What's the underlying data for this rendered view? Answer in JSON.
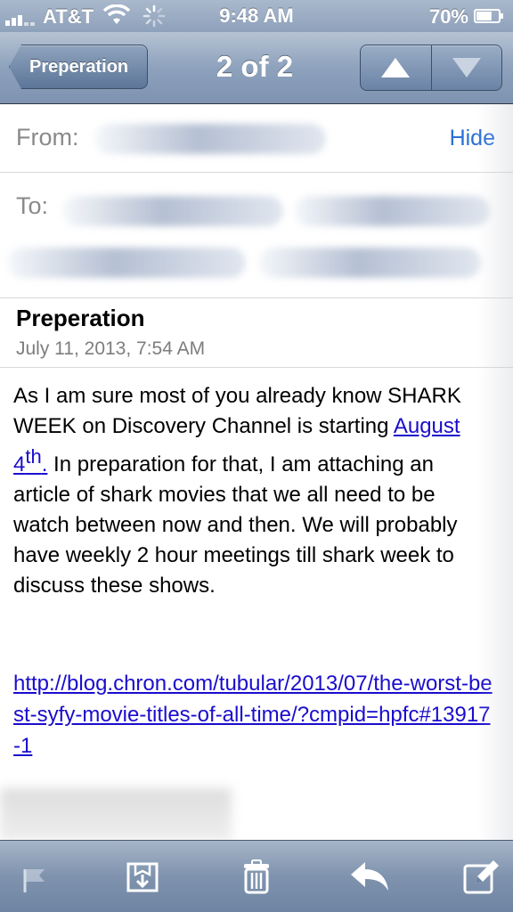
{
  "status_bar": {
    "carrier": "AT&T",
    "time": "9:48 AM",
    "battery_percent": "70%",
    "battery_level": 0.7,
    "icons": [
      "signal-icon",
      "wifi-icon",
      "activity-spinner-icon",
      "battery-icon"
    ]
  },
  "nav": {
    "back_label": "Preperation",
    "title": "2 of 2",
    "prev_icon": "arrow-up-icon",
    "next_icon": "arrow-down-icon"
  },
  "header": {
    "from_label": "From:",
    "to_label": "To:",
    "hide_label": "Hide"
  },
  "message": {
    "subject": "Preperation",
    "date": "July 11, 2013, 7:54 AM",
    "body_part1": "As I am sure most of you already know SHARK WEEK on Discovery Channel is starting ",
    "date_link": "August 4",
    "date_link_sup": "th",
    "date_link_end": ".",
    "body_part2": " In preparation for that, I am attaching an article of shark movies that we all need to be watch between now and then. We will probably have weekly 2 hour meetings till shark week to discuss these shows.",
    "url": "http://blog.chron.com/tubular/2013/07/the-worst-best-syfy-movie-titles-of-all-time/?cmpid=hpfc#13917-1"
  },
  "toolbar": {
    "icons": [
      "flag-icon",
      "move-to-folder-icon",
      "trash-icon",
      "reply-icon",
      "compose-icon"
    ]
  },
  "colors": {
    "link": "#1a0dcc",
    "hide_link": "#2a6fd6",
    "bar_blue": "#8ea2bd"
  }
}
